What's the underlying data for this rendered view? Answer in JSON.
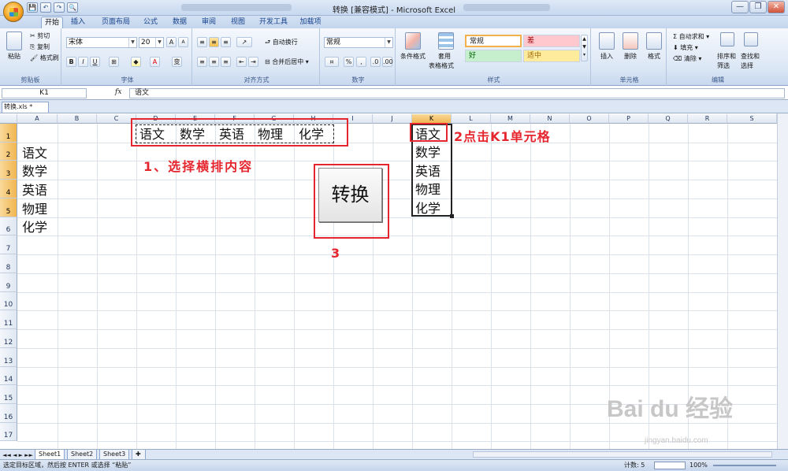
{
  "window": {
    "title": "转换  [兼容模式] - Microsoft Excel",
    "qat": [
      "💾",
      "↶",
      "↷",
      "🔍"
    ],
    "controls": [
      "—",
      "❐",
      "✕"
    ]
  },
  "ribbon_tabs": [
    "开始",
    "插入",
    "页面布局",
    "公式",
    "数据",
    "审阅",
    "视图",
    "开发工具",
    "加载项"
  ],
  "ribbon": {
    "clipboard": {
      "label": "剪贴板",
      "paste": "粘贴",
      "cut": "剪切",
      "copy": "复制",
      "format_painter": "格式刷"
    },
    "font": {
      "label": "字体",
      "name": "宋体",
      "size": "20",
      "grow": "A",
      "shrink": "A"
    },
    "alignment": {
      "label": "对齐方式",
      "wrap": "自动换行",
      "merge": "合并后居中"
    },
    "number": {
      "label": "数字",
      "format": "常规"
    },
    "styles": {
      "label": "样式",
      "conditional": "条件格式",
      "table": "套用",
      "table2": "表格格式",
      "cells": [
        "常规",
        "差",
        "好",
        "适中"
      ]
    },
    "cells": {
      "label": "单元格",
      "insert": "插入",
      "delete": "删除",
      "format": "格式"
    },
    "editing": {
      "label": "编辑",
      "autosum": "自动求和",
      "fill": "填充",
      "clear": "清除",
      "sort": "排序和",
      "sort2": "筛选",
      "find": "查找和",
      "find2": "选择"
    }
  },
  "formula_bar": {
    "name_box": "K1",
    "fx": "fx",
    "value": "语文"
  },
  "workbook_tab": "转换.xls *",
  "columns": [
    "A",
    "B",
    "C",
    "D",
    "E",
    "F",
    "G",
    "H",
    "I",
    "J",
    "K",
    "L",
    "M",
    "N",
    "O",
    "P",
    "Q",
    "R",
    "S"
  ],
  "rows": [
    "1",
    "2",
    "3",
    "4",
    "5",
    "6",
    "7",
    "8",
    "9",
    "10",
    "11",
    "12",
    "13",
    "14",
    "15",
    "16",
    "17"
  ],
  "cells": {
    "col_a": [
      "语文",
      "数学",
      "英语",
      "物理",
      "化学"
    ],
    "row1_source": [
      "语文",
      "数学",
      "英语",
      "物理",
      "化学"
    ],
    "col_k": [
      "语文",
      "数学",
      "英语",
      "物理",
      "化学"
    ]
  },
  "annotations": {
    "step1": "1、选择横排内容",
    "step2": "2点击K1单元格",
    "step3": "3"
  },
  "convert_button": "转换",
  "sheets": [
    "Sheet1",
    "Sheet2",
    "Sheet3"
  ],
  "status": {
    "message": "选定目标区域，然后按 ENTER 或选择 “粘贴”",
    "count": "计数: 5",
    "zoom": "100%"
  },
  "watermark": {
    "main": "Bai du 经验",
    "sub": "jingyan.baidu.com"
  }
}
